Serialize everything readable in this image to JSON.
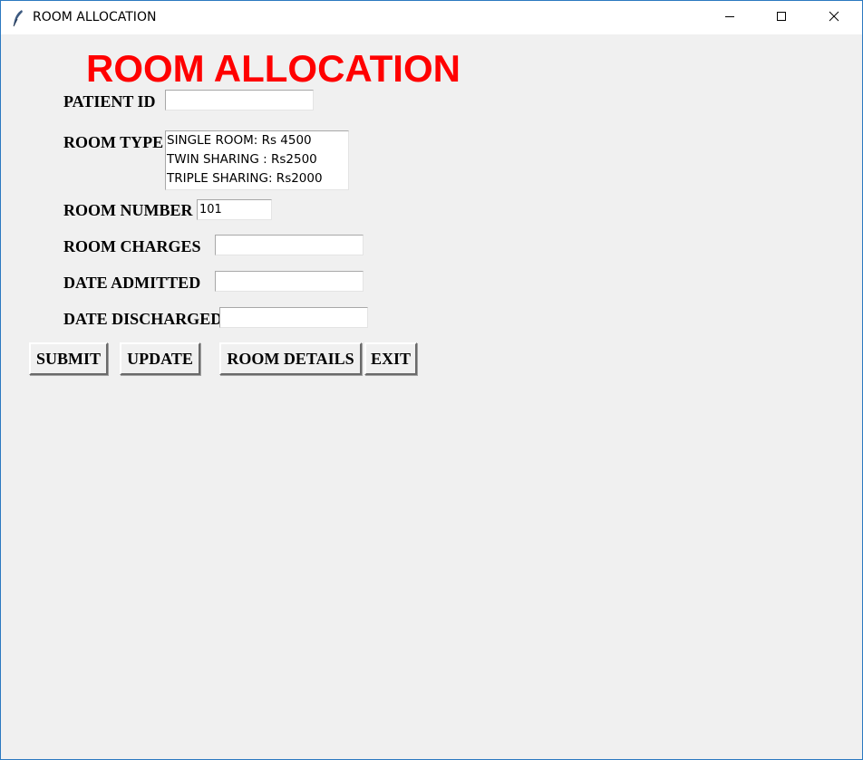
{
  "window": {
    "title": "ROOM ALLOCATION",
    "controls": {
      "minimize": "minimize-icon",
      "maximize": "maximize-icon",
      "close": "close-icon"
    }
  },
  "form": {
    "heading": "ROOM ALLOCATION",
    "heading_color": "#ff0000",
    "patient_id": {
      "label": "PATIENT ID",
      "value": ""
    },
    "room_type": {
      "label": "ROOM TYPE",
      "options": [
        "SINGLE ROOM: Rs 4500",
        "TWIN SHARING : Rs2500",
        "TRIPLE SHARING: Rs2000"
      ]
    },
    "room_number": {
      "label": "ROOM NUMBER",
      "value": "101"
    },
    "room_charges": {
      "label": "ROOM CHARGES",
      "value": ""
    },
    "date_admitted": {
      "label": "DATE ADMITTED",
      "value": ""
    },
    "date_discharged": {
      "label": "DATE DISCHARGED",
      "value": ""
    }
  },
  "buttons": {
    "submit": "SUBMIT",
    "update": "UPDATE",
    "room_details": "ROOM DETAILS",
    "exit": "EXIT"
  }
}
